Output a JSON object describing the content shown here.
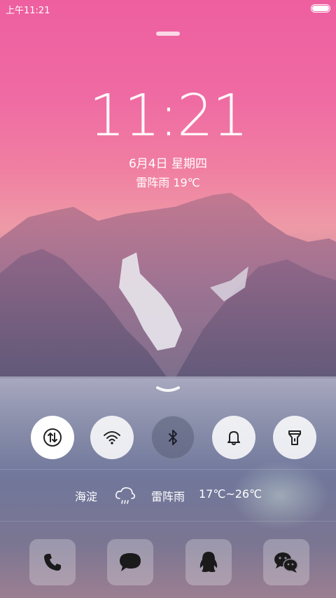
{
  "status_bar": {
    "time": "上午11:21",
    "battery_level": 1.0
  },
  "lock": {
    "clock": "11:21",
    "date": "6月4日  星期四",
    "weather": "雷阵雨 19℃"
  },
  "quick_toggles": [
    {
      "name": "data-toggle",
      "icon": "data-transfer-icon",
      "state": "on"
    },
    {
      "name": "wifi-toggle",
      "icon": "wifi-icon",
      "state": "on"
    },
    {
      "name": "bluetooth-toggle",
      "icon": "bluetooth-icon",
      "state": "off"
    },
    {
      "name": "sound-toggle",
      "icon": "bell-icon",
      "state": "on"
    },
    {
      "name": "flashlight-toggle",
      "icon": "flashlight-icon",
      "state": "on"
    }
  ],
  "weather_bar": {
    "location": "海淀",
    "icon": "thunder-rain-icon",
    "condition": "雷阵雨",
    "range": "17℃~26℃"
  },
  "dock": [
    {
      "name": "phone",
      "icon": "phone-icon"
    },
    {
      "name": "messages",
      "icon": "message-bubble-icon"
    },
    {
      "name": "qq",
      "icon": "qq-penguin-icon"
    },
    {
      "name": "wechat",
      "icon": "wechat-icon"
    }
  ]
}
